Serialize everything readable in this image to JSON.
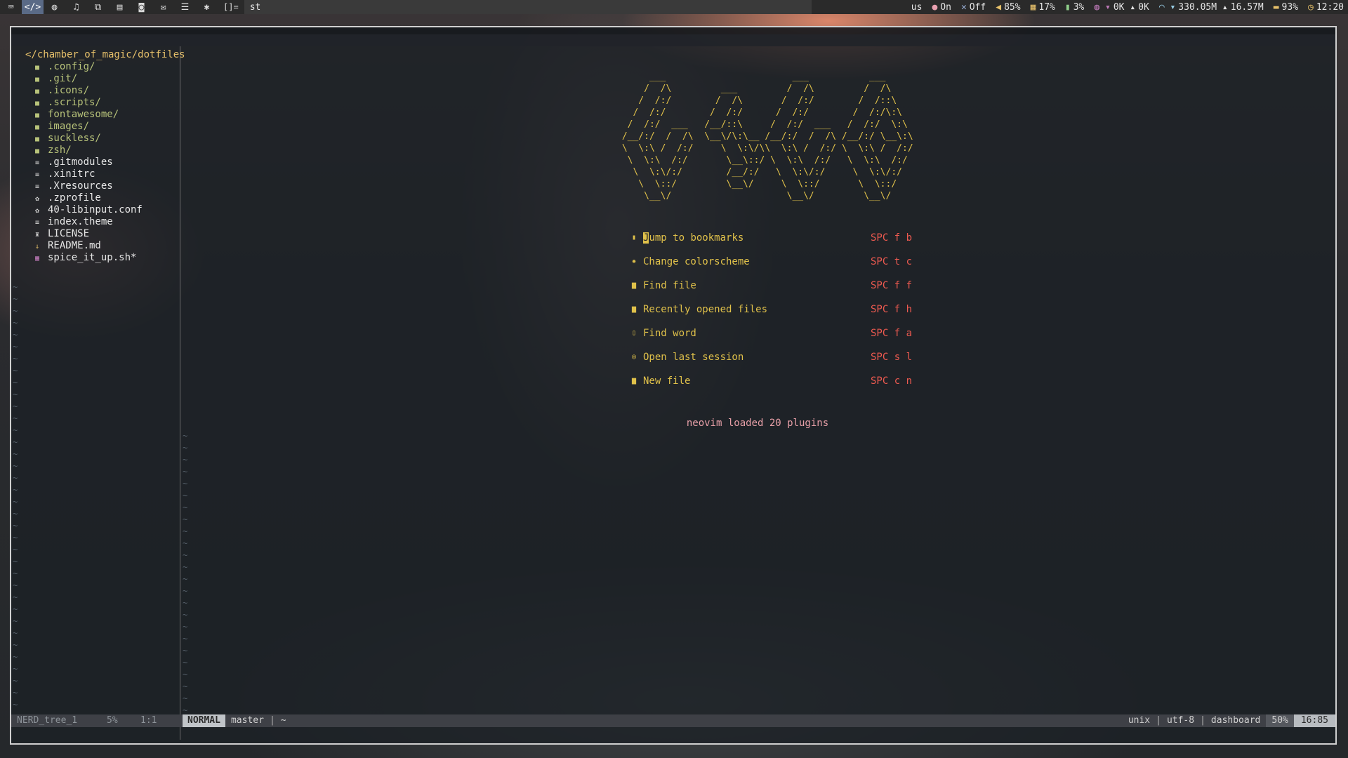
{
  "topbar": {
    "tags": [
      {
        "icon": "terminal-icon",
        "glyph": "⌨"
      },
      {
        "icon": "code-icon",
        "glyph": "</>"
      },
      {
        "icon": "globe-icon",
        "glyph": "◍"
      },
      {
        "icon": "music-icon",
        "glyph": "♫"
      },
      {
        "icon": "windows-icon",
        "glyph": "⧉"
      },
      {
        "icon": "document-icon",
        "glyph": "▤"
      },
      {
        "icon": "chat-icon",
        "glyph": "◙"
      },
      {
        "icon": "mail-icon",
        "glyph": "✉"
      },
      {
        "icon": "list-icon",
        "glyph": "☰"
      },
      {
        "icon": "asterisk-icon",
        "glyph": "✱"
      }
    ],
    "layout_symbol": "[]=",
    "window_title": "st",
    "status": {
      "keyboard": "us",
      "lock": "On",
      "mic": "Off",
      "volume": "85%",
      "cpu": "17%",
      "memory": "3%",
      "net_down": "0K",
      "net_up": "0K",
      "wifi_down": "330.05M",
      "wifi_up": "16.57M",
      "battery": "93%",
      "clock": "12:20"
    }
  },
  "tree": {
    "root": "</chamber_of_magic/dotfiles",
    "items": [
      {
        "name": ".config/",
        "kind": "dir"
      },
      {
        "name": ".git/",
        "kind": "dir"
      },
      {
        "name": ".icons/",
        "kind": "dir"
      },
      {
        "name": ".scripts/",
        "kind": "dir"
      },
      {
        "name": "fontawesome/",
        "kind": "dir"
      },
      {
        "name": "images/",
        "kind": "dir"
      },
      {
        "name": "suckless/",
        "kind": "dir"
      },
      {
        "name": "zsh/",
        "kind": "dir"
      },
      {
        "name": ".gitmodules",
        "kind": "file"
      },
      {
        "name": ".xinitrc",
        "kind": "file"
      },
      {
        "name": ".Xresources",
        "kind": "file"
      },
      {
        "name": ".zprofile",
        "kind": "gear"
      },
      {
        "name": "40-libinput.conf",
        "kind": "gear"
      },
      {
        "name": "index.theme",
        "kind": "file"
      },
      {
        "name": "LICENSE",
        "kind": "license"
      },
      {
        "name": "README.md",
        "kind": "readme"
      },
      {
        "name": "spice_it_up.sh*",
        "kind": "sh"
      }
    ]
  },
  "dashboard": {
    "ascii_art": "      ___                       ___           ___     \n     /  /\\         ___         /  /\\         /  /\\    \n    /  /:/        /  /\\       /  /:/        /  /::\\   \n   /  /:/        /  /:/      /  /:/        /  /:/\\:\\  \n  /  /:/  ___   /__/::\\     /  /:/  ___   /  /:/  \\:\\ \n /__/:/  /  /\\  \\__\\/\\:\\__ /__/:/  /  /\\ /__/:/ \\__\\:\\\n \\  \\:\\ /  /:/     \\  \\:\\/\\\\  \\:\\ /  /:/ \\  \\:\\ /  /:/\n  \\  \\:\\  /:/       \\__\\::/ \\  \\:\\  /:/   \\  \\:\\  /:/ \n   \\  \\:\\/:/        /__/:/   \\  \\:\\/:/     \\  \\:\\/:/  \n    \\  \\::/         \\__\\/     \\  \\::/       \\  \\::/   \n     \\__\\/                     \\__\\/         \\__\\/    ",
    "entries": [
      {
        "icon": "bookmark-icon",
        "glyph": "▮",
        "first": "J",
        "rest": "ump to bookmarks",
        "keys": "SPC f b"
      },
      {
        "icon": "palette-icon",
        "glyph": "✹",
        "first": "",
        "rest": "Change colorscheme",
        "keys": "SPC t c"
      },
      {
        "icon": "file-icon",
        "glyph": "▆",
        "first": "",
        "rest": "Find file",
        "keys": "SPC f f"
      },
      {
        "icon": "history-file-icon",
        "glyph": "▆",
        "first": "",
        "rest": "Recently opened files",
        "keys": "SPC f h"
      },
      {
        "icon": "search-file-icon",
        "glyph": "▯",
        "first": "",
        "rest": "Find word",
        "keys": "SPC f a"
      },
      {
        "icon": "session-icon",
        "glyph": "◎",
        "first": "",
        "rest": "Open last session",
        "keys": "SPC s l"
      },
      {
        "icon": "new-file-icon",
        "glyph": "▆",
        "first": "",
        "rest": "New file",
        "keys": "SPC c n"
      }
    ],
    "footer": "neovim loaded 20 plugins"
  },
  "statusline": {
    "tree_name": "NERD_tree_1",
    "tree_percent": "5%",
    "tree_position": "1:1",
    "mode": "NORMAL",
    "branch": "master",
    "separator": "|",
    "dash": "~",
    "format": "unix",
    "encoding": "utf-8",
    "filetype": "dashboard",
    "scroll_percent": "50%",
    "position": "16:85"
  },
  "colors": {
    "accent_yellow": "#e0c14a",
    "key_red": "#ee5a50",
    "footer_pink": "#e8a0a8",
    "tree_dir_green": "#b8c37a"
  }
}
